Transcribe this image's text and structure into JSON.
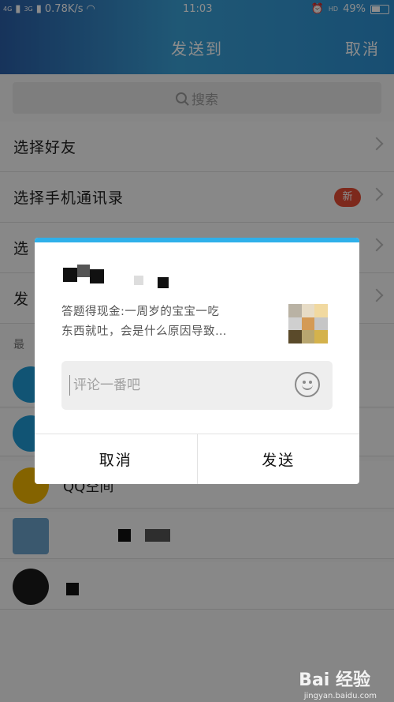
{
  "status_bar": {
    "network_left": "4G",
    "network_right": "3G",
    "speed": "0.78K/s",
    "time": "11:03",
    "hd": "HD",
    "battery": "49%"
  },
  "header": {
    "title": "发送到",
    "cancel": "取消"
  },
  "search": {
    "label": "搜索"
  },
  "list": [
    {
      "label": "选择好友"
    },
    {
      "label": "选择手机通讯录",
      "badge": "新"
    },
    {
      "label": "选"
    },
    {
      "label": "发"
    }
  ],
  "section_label": "最",
  "contacts": [
    {
      "name": ""
    },
    {
      "name": ""
    },
    {
      "name": "QQ空间"
    },
    {
      "name": ""
    },
    {
      "name": ""
    }
  ],
  "dialog": {
    "article_line1": "答题得现金:一周岁的宝宝一吃",
    "article_line2": "东西就吐，会是什么原因导致…",
    "comment_placeholder": "评论一番吧",
    "cancel": "取消",
    "send": "发送"
  },
  "colors": {
    "header_gradient_start": "#2a5ea6",
    "accent": "#2fb0ea",
    "badge": "#e34b34"
  },
  "watermark": {
    "text": "Bai 经验",
    "url": "jingyan.baidu.com"
  }
}
